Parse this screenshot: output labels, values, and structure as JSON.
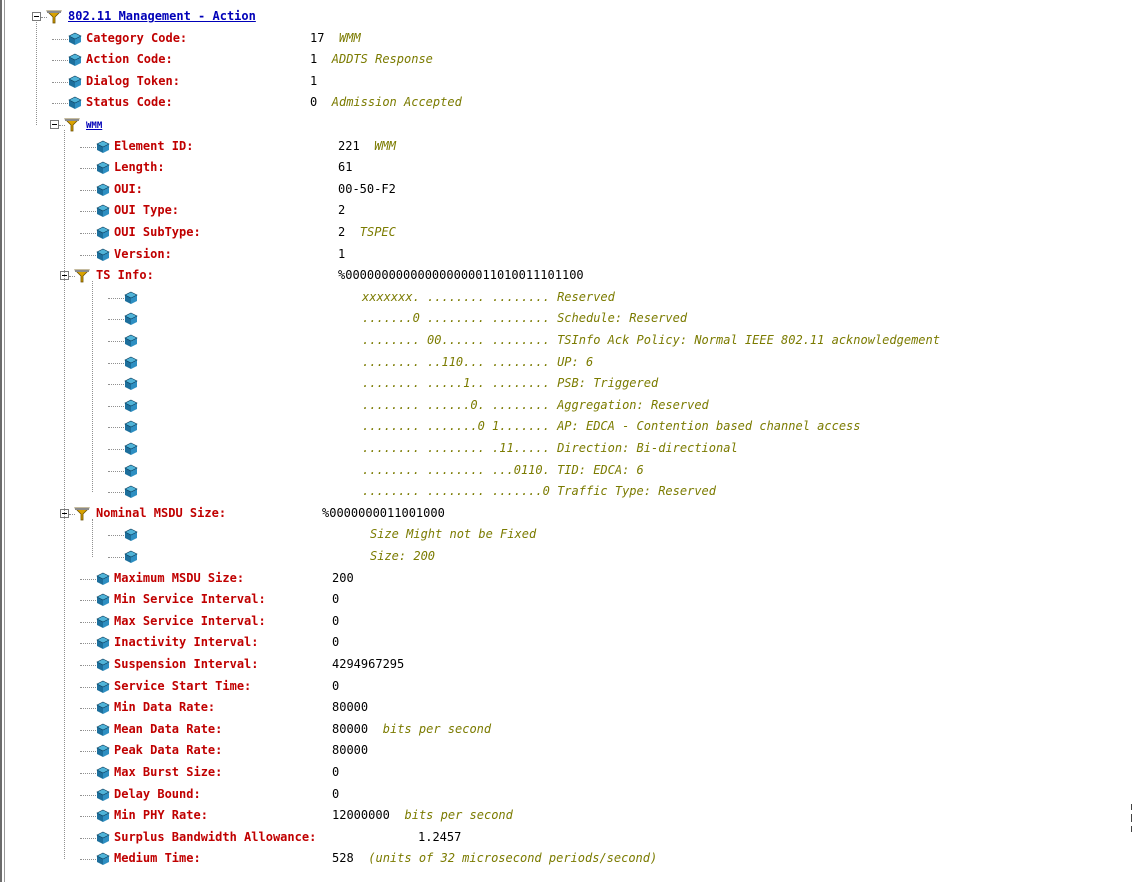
{
  "window": {
    "title": "802.11 Management - Action decode pane"
  },
  "icons": {
    "field": "field-cube-icon",
    "header": "header-filter-icon",
    "expander": "collapse-minus-icon"
  },
  "colors": {
    "field_name": "#c00000",
    "header_name": "#0000b8",
    "description": "#7b7b00",
    "value": "#000000"
  },
  "rows": [
    {
      "kind": "header",
      "depth": 0,
      "name": "802.11 Management - Action",
      "value": "",
      "desc": ""
    },
    {
      "kind": "field",
      "depth": 1,
      "name": "Category Code:",
      "value": "17",
      "desc": "WMM"
    },
    {
      "kind": "field",
      "depth": 1,
      "name": "Action Code:",
      "value": "1",
      "desc": "ADDTS Response"
    },
    {
      "kind": "field",
      "depth": 1,
      "name": "Dialog Token:",
      "value": "1",
      "desc": ""
    },
    {
      "kind": "field",
      "depth": 1,
      "name": "Status Code:",
      "value": "0",
      "desc": "Admission Accepted"
    },
    {
      "kind": "header",
      "depth": 1,
      "name": "WMM",
      "value": "",
      "desc": "",
      "small": true
    },
    {
      "kind": "field",
      "depth": 2,
      "name": "Element ID:",
      "value": "221",
      "desc": "WMM"
    },
    {
      "kind": "field",
      "depth": 2,
      "name": "Length:",
      "value": "61",
      "desc": ""
    },
    {
      "kind": "field",
      "depth": 2,
      "name": "OUI:",
      "value": "00-50-F2",
      "desc": ""
    },
    {
      "kind": "field",
      "depth": 2,
      "name": "OUI Type:",
      "value": "2",
      "desc": ""
    },
    {
      "kind": "field",
      "depth": 2,
      "name": "OUI SubType:",
      "value": "2",
      "desc": "TSPEC"
    },
    {
      "kind": "field",
      "depth": 2,
      "name": "Version:",
      "value": "1",
      "desc": ""
    },
    {
      "kind": "subhead",
      "depth": 2,
      "name": "TS Info:",
      "value": "%000000000000000000011010011101100",
      "desc": ""
    },
    {
      "kind": "bit",
      "depth": 3,
      "text": "xxxxxxx. ........ ........ Reserved"
    },
    {
      "kind": "bit",
      "depth": 3,
      "text": ".......0 ........ ........ Schedule: Reserved"
    },
    {
      "kind": "bit",
      "depth": 3,
      "text": "........ 00...... ........ TSInfo Ack Policy: Normal IEEE 802.11 acknowledgement"
    },
    {
      "kind": "bit",
      "depth": 3,
      "text": "........ ..110... ........ UP: 6"
    },
    {
      "kind": "bit",
      "depth": 3,
      "text": "........ .....1.. ........ PSB: Triggered"
    },
    {
      "kind": "bit",
      "depth": 3,
      "text": "........ ......0. ........ Aggregation: Reserved"
    },
    {
      "kind": "bit",
      "depth": 3,
      "text": "........ .......0 1....... AP: EDCA - Contention based channel access"
    },
    {
      "kind": "bit",
      "depth": 3,
      "text": "........ ........ .11..... Direction: Bi-directional"
    },
    {
      "kind": "bit",
      "depth": 3,
      "text": "........ ........ ...0110. TID: EDCA: 6"
    },
    {
      "kind": "bit",
      "depth": 3,
      "text": "........ ........ .......0 Traffic Type: Reserved"
    },
    {
      "kind": "subhead",
      "depth": 2,
      "name": "Nominal MSDU Size:",
      "value": "%0000000011001000",
      "desc": ""
    },
    {
      "kind": "bit",
      "depth": 3,
      "text": "Size Might not be Fixed"
    },
    {
      "kind": "bit",
      "depth": 3,
      "text": "Size: 200"
    },
    {
      "kind": "field",
      "depth": 2,
      "name": "Maximum MSDU Size:",
      "value": "200",
      "desc": ""
    },
    {
      "kind": "field",
      "depth": 2,
      "name": "Min Service Interval:",
      "value": "0",
      "desc": "",
      "tight": true
    },
    {
      "kind": "field",
      "depth": 2,
      "name": "Max Service Interval:",
      "value": "0",
      "desc": "",
      "tight": true
    },
    {
      "kind": "field",
      "depth": 2,
      "name": "Inactivity Interval:",
      "value": "0",
      "desc": ""
    },
    {
      "kind": "field",
      "depth": 2,
      "name": "Suspension Interval:",
      "value": "4294967295",
      "desc": ""
    },
    {
      "kind": "field",
      "depth": 2,
      "name": "Service Start Time:",
      "value": "0",
      "desc": ""
    },
    {
      "kind": "field",
      "depth": 2,
      "name": "Min Data Rate:",
      "value": "80000",
      "desc": ""
    },
    {
      "kind": "field",
      "depth": 2,
      "name": "Mean Data Rate:",
      "value": "80000",
      "desc": "bits per second"
    },
    {
      "kind": "field",
      "depth": 2,
      "name": "Peak Data Rate:",
      "value": "80000",
      "desc": ""
    },
    {
      "kind": "field",
      "depth": 2,
      "name": "Max Burst Size:",
      "value": "0",
      "desc": ""
    },
    {
      "kind": "field",
      "depth": 2,
      "name": "Delay Bound:",
      "value": "0",
      "desc": ""
    },
    {
      "kind": "field",
      "depth": 2,
      "name": "Min PHY Rate:",
      "value": "12000000",
      "desc": "bits per second"
    },
    {
      "kind": "field",
      "depth": 2,
      "name": "Surplus Bandwidth Allowance:",
      "value": "1.2457",
      "desc": "",
      "tight": true
    },
    {
      "kind": "field",
      "depth": 2,
      "name": "Medium Time:",
      "value": "528",
      "desc": "(units of 32 microsecond periods/second)"
    }
  ]
}
